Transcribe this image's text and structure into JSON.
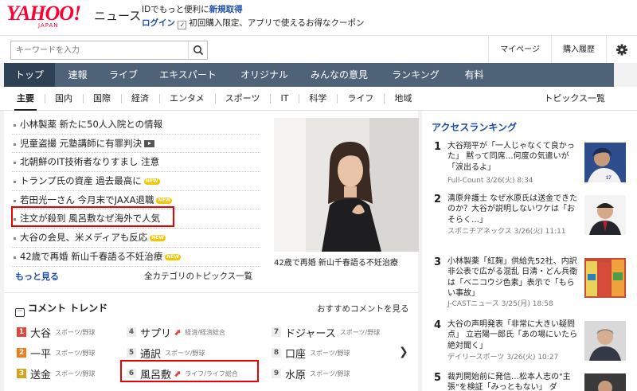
{
  "header": {
    "logo_text": "YAHOO!",
    "logo_sub": "JAPAN",
    "section_label": "ニュース",
    "promo_line1_prefix": "IDでもっと便利に",
    "promo_line1_link": "新規取得",
    "promo_line2_link": "ログイン",
    "promo_line2_text": "初回購入限定、アプリで使えるお得なクーポン"
  },
  "search": {
    "placeholder": "キーワードを入力",
    "mypage": "マイページ",
    "history": "購入履歴"
  },
  "global_nav": [
    "トップ",
    "速報",
    "ライブ",
    "エキスパート",
    "オリジナル",
    "みんなの意見",
    "ランキング",
    "有料"
  ],
  "sub_nav": [
    "主要",
    "国内",
    "国際",
    "経済",
    "エンタメ",
    "スポーツ",
    "IT",
    "科学",
    "ライフ",
    "地域"
  ],
  "sub_nav_right": "トピックス一覧",
  "headlines": [
    {
      "text": "小林製薬 新たに50人入院との情報"
    },
    {
      "text": "児童盗撮 元塾講師に有罪判決",
      "video": true
    },
    {
      "text": "北朝鮮のIT技術者なりすまし 注意"
    },
    {
      "text": "トランプ氏の資産 過去最高に",
      "badge": "NEW"
    },
    {
      "text": "若田光一さん 今月末でJAXA退職",
      "badge": "NEW"
    },
    {
      "text": "注文が殺到 風呂敷なぜ海外で人気"
    },
    {
      "text": "大谷の会見、米メディアも反応",
      "badge": "NEW"
    },
    {
      "text": "42歳で再婚 新山千春語る不妊治療",
      "badge": "NEW"
    }
  ],
  "more_label": "もっと見る",
  "all_topics_label": "全カテゴリのトピックス一覧",
  "photo_caption": "42歳で再婚 新山千春語る不妊治療",
  "trend": {
    "title": "コメント トレンド",
    "recommend_link": "おすすめコメントを見る",
    "items": [
      {
        "rank": "1",
        "word": "大谷",
        "category": "スポーツ/野球",
        "rising": false
      },
      {
        "rank": "2",
        "word": "一平",
        "category": "スポーツ/野球",
        "rising": false
      },
      {
        "rank": "3",
        "word": "送金",
        "category": "スポーツ/野球",
        "rising": false
      },
      {
        "rank": "4",
        "word": "サプリ",
        "category": "経済/経済総合",
        "rising": true
      },
      {
        "rank": "5",
        "word": "通訳",
        "category": "スポーツ/野球",
        "rising": false
      },
      {
        "rank": "6",
        "word": "風呂敷",
        "category": "ライフ/ライフ総合",
        "rising": true
      },
      {
        "rank": "7",
        "word": "ドジャース",
        "category": "スポーツ/野球",
        "rising": false
      },
      {
        "rank": "8",
        "word": "口座",
        "category": "スポーツ/野球",
        "rising": false
      },
      {
        "rank": "9",
        "word": "水原",
        "category": "スポーツ/野球",
        "rising": false
      }
    ]
  },
  "access_ranking": {
    "title": "アクセスランキング",
    "items": [
      {
        "rank": "1",
        "title": "大谷翔平が「一人じゃなくて良かった」 黙って同席…何度の気遣いが「涙出るよ」",
        "source": "Full-Count 3/26(火) 8:34"
      },
      {
        "rank": "2",
        "title": "清原弁護士 なぜ水原氏は送金できたのか？大谷が説明しないワケは「おそらく…」",
        "source": "スポニチアネックス 3/26(火) 11:11"
      },
      {
        "rank": "3",
        "title": "小林製薬「紅麹」供給先52社、内訳非公表で広がる混乱 日清・どん兵衛は「ベニコウジ色素」表示で「もらい事故」",
        "source": "J-CASTニュース 3/25(月) 18:58"
      },
      {
        "rank": "4",
        "title": "大谷の声明発表「非常に大きい疑問点」 立岩陽一郎氏「あの場にいたら絶対聞く」",
        "source": "デイリースポーツ 3/26(火) 10:27"
      },
      {
        "rank": "5",
        "title": "裁判開始前に発信…松本人志の\"主張\"を検証「みっともない」 ダ",
        "source": ""
      }
    ]
  },
  "colors": {
    "nav_bg": "#4e6378",
    "nav_active": "#2f4154",
    "link": "#1b4ea8",
    "highlight": "#ee0000"
  }
}
